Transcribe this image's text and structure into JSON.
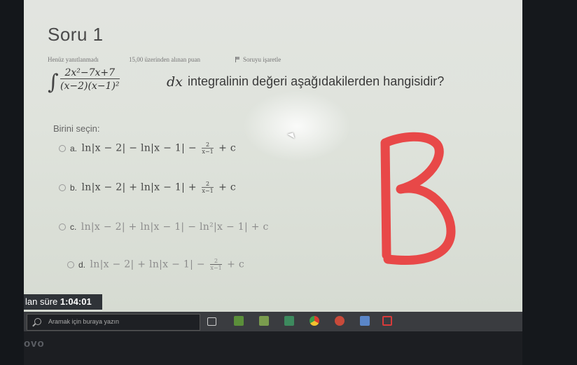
{
  "question": {
    "title": "Soru 1",
    "status": "Henüz yanıtlanmadı",
    "points": "15,00 üzerinden alınan puan",
    "flag_label": "Soruyu işaretle",
    "integrand_num": "2x²−7x+7",
    "integrand_den": "(x−2)(x−1)²",
    "dx": "dx",
    "text": "integralinin değeri aşağıdakilerden hangisidir?",
    "choose_label": "Birini seçin:"
  },
  "options": [
    {
      "label": "a.",
      "pre": "ln|x − 2| − ln|x − 1| −",
      "num": "2",
      "den": "x−1",
      "post": "+ c"
    },
    {
      "label": "b.",
      "pre": "ln|x − 2| + ln|x − 1| +",
      "num": "2",
      "den": "x−1",
      "post": "+ c"
    },
    {
      "label": "c.",
      "text": "ln|x − 2| + ln|x − 1| − ln²|x − 1| + c"
    },
    {
      "label": "d.",
      "pre": "ln|x − 2| + ln|x − 1| −",
      "num": "2",
      "den": "x−1",
      "post": "+ c"
    }
  ],
  "timer": {
    "prefix": "lan süre",
    "value": "1:04:01"
  },
  "taskbar": {
    "search_placeholder": "Aramak için buraya yazın",
    "icons": [
      "task-view-icon",
      "app-icon-1",
      "store-icon",
      "app-icon-2",
      "chrome-icon",
      "app-icon-3",
      "app-icon-4",
      "antivirus-icon"
    ]
  },
  "bezel": {
    "logo": "ovo"
  },
  "annotation": {
    "letter": "B",
    "color": "#e84848"
  },
  "colors": {
    "screen_bg": "#e0e3dd",
    "taskbar": "#3a3c40",
    "timer_bg": "#2f3338"
  }
}
